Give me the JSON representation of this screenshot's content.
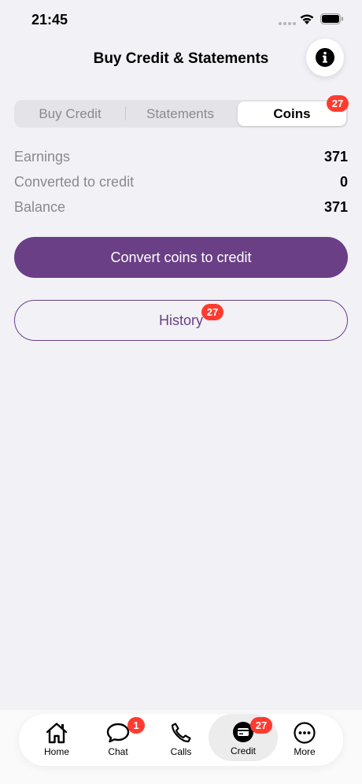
{
  "status_bar": {
    "time": "21:45"
  },
  "header": {
    "title": "Buy Credit & Statements"
  },
  "segments": [
    {
      "label": "Buy Credit"
    },
    {
      "label": "Statements"
    },
    {
      "label": "Coins",
      "badge": "27",
      "selected": true
    }
  ],
  "stats": [
    {
      "label": "Earnings",
      "value": "371"
    },
    {
      "label": "Converted to credit",
      "value": "0"
    },
    {
      "label": "Balance",
      "value": "371"
    }
  ],
  "buttons": {
    "convert_label": "Convert coins to credit",
    "history_label": "History",
    "history_badge": "27"
  },
  "tabbar": {
    "items": [
      {
        "label": "Home",
        "icon": "home-icon"
      },
      {
        "label": "Chat",
        "icon": "chat-icon",
        "badge": "1"
      },
      {
        "label": "Calls",
        "icon": "phone-icon"
      },
      {
        "label": "Credit",
        "icon": "credit-card-icon",
        "badge": "27",
        "active": true
      },
      {
        "label": "More",
        "icon": "more-icon"
      }
    ]
  },
  "colors": {
    "accent": "#6a3f86",
    "badge": "#ff3b30",
    "background": "#f2f1f6"
  }
}
